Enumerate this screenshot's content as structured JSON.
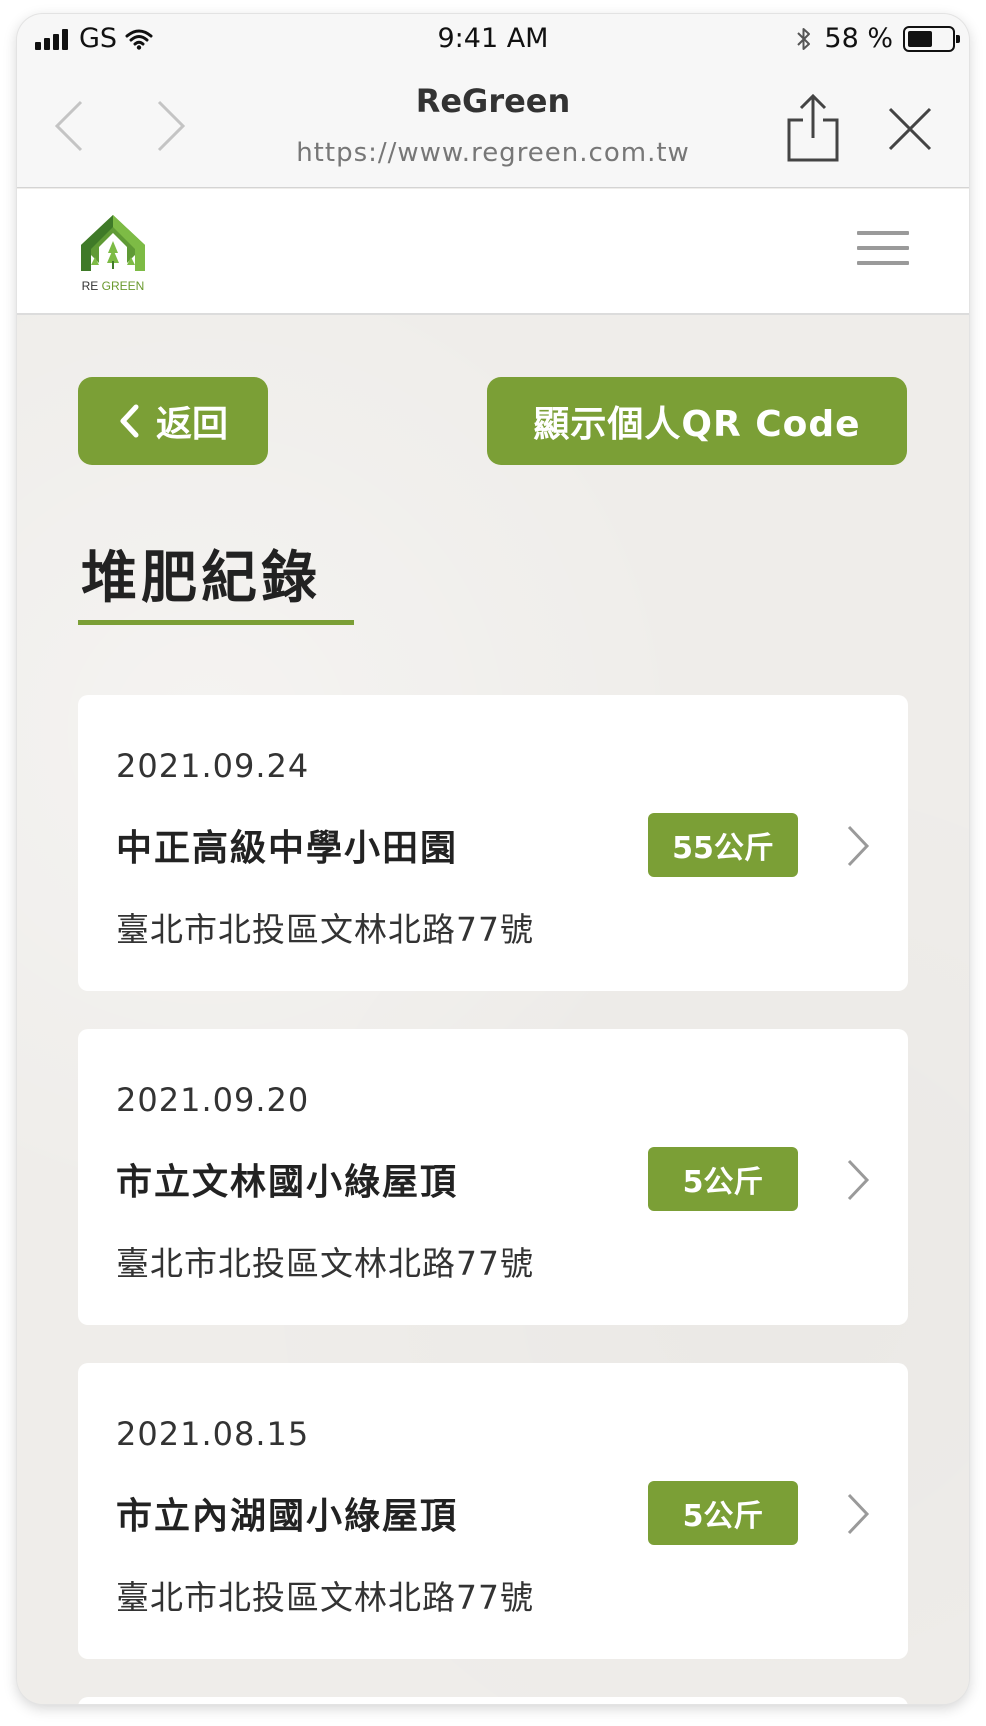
{
  "status_bar": {
    "carrier": "GS",
    "time": "9:41 AM",
    "battery_text": "58 %",
    "battery_level": 0.58
  },
  "browser": {
    "title": "ReGreen",
    "url": "https://www.regreen.com.tw"
  },
  "site_header": {
    "logo_text_re": "RE",
    "logo_text_green": "GREEN"
  },
  "actions": {
    "back_label": "返回",
    "qr_label": "顯示個人QR Code"
  },
  "page_title": "堆肥紀錄",
  "records": [
    {
      "date": "2021.09.24",
      "name": "中正高級中學小田園",
      "amount": "55公斤",
      "address": "臺北市北投區文林北路77號"
    },
    {
      "date": "2021.09.20",
      "name": "市立文林國小綠屋頂",
      "amount": "5公斤",
      "address": "臺北市北投區文林北路77號"
    },
    {
      "date": "2021.08.15",
      "name": "市立內湖國小綠屋頂",
      "amount": "5公斤",
      "address": "臺北市北投區文林北路77號"
    }
  ],
  "colors": {
    "accent": "#7b9f36",
    "background": "#efedea",
    "card": "#ffffff"
  }
}
